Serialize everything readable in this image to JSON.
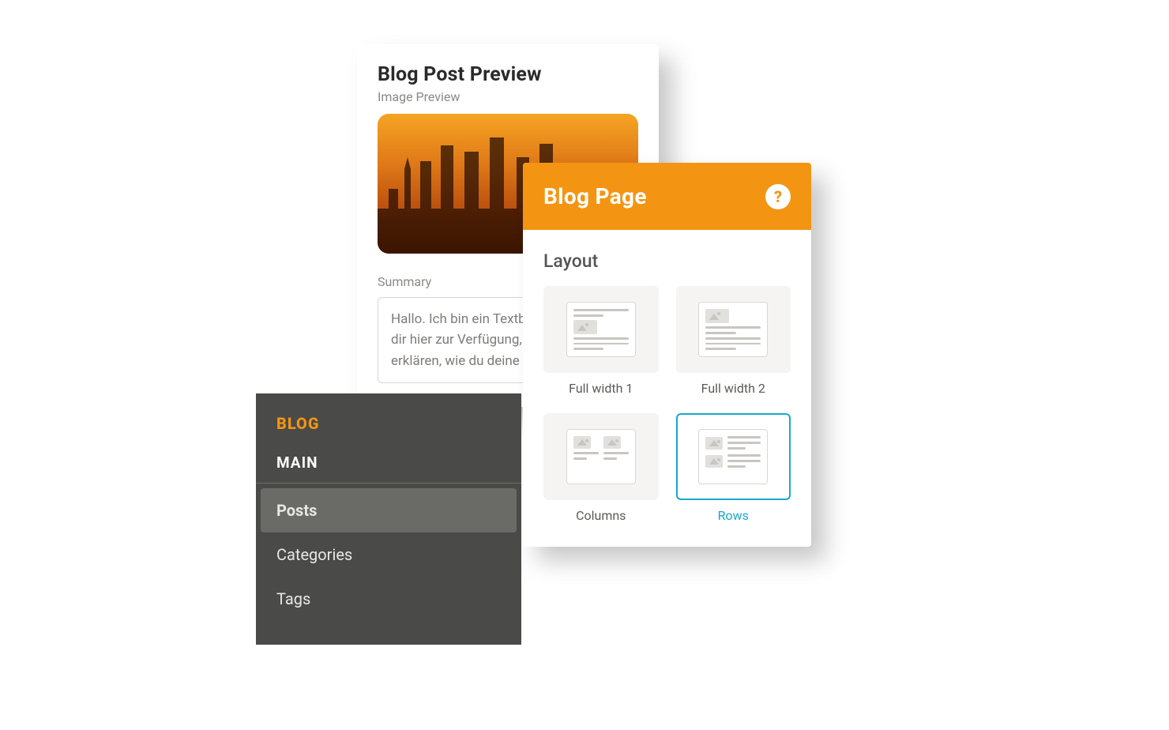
{
  "preview": {
    "title": "Blog Post Preview",
    "image_label": "Image Preview",
    "summary_label": "Summary",
    "summary_text": "Hallo. Ich bin ein Textb\ndir hier zur Verfügung,\nerklären, wie du deine"
  },
  "layout_panel": {
    "header_title": "Blog Page",
    "help_glyph": "?",
    "section_title": "Layout",
    "options": [
      {
        "label": "Full width 1",
        "selected": false,
        "kind": "full1"
      },
      {
        "label": "Full width 2",
        "selected": false,
        "kind": "full2"
      },
      {
        "label": "Columns",
        "selected": false,
        "kind": "cols"
      },
      {
        "label": "Rows",
        "selected": true,
        "kind": "rows"
      }
    ]
  },
  "sidebar": {
    "heading": "BLOG",
    "section_label": "MAIN",
    "items": [
      {
        "label": "Posts",
        "active": true
      },
      {
        "label": "Categories",
        "active": false
      },
      {
        "label": "Tags",
        "active": false
      }
    ]
  },
  "colors": {
    "accent_orange": "#f39513",
    "accent_blue": "#17a9cc",
    "sidebar_bg": "#4a4a48"
  }
}
